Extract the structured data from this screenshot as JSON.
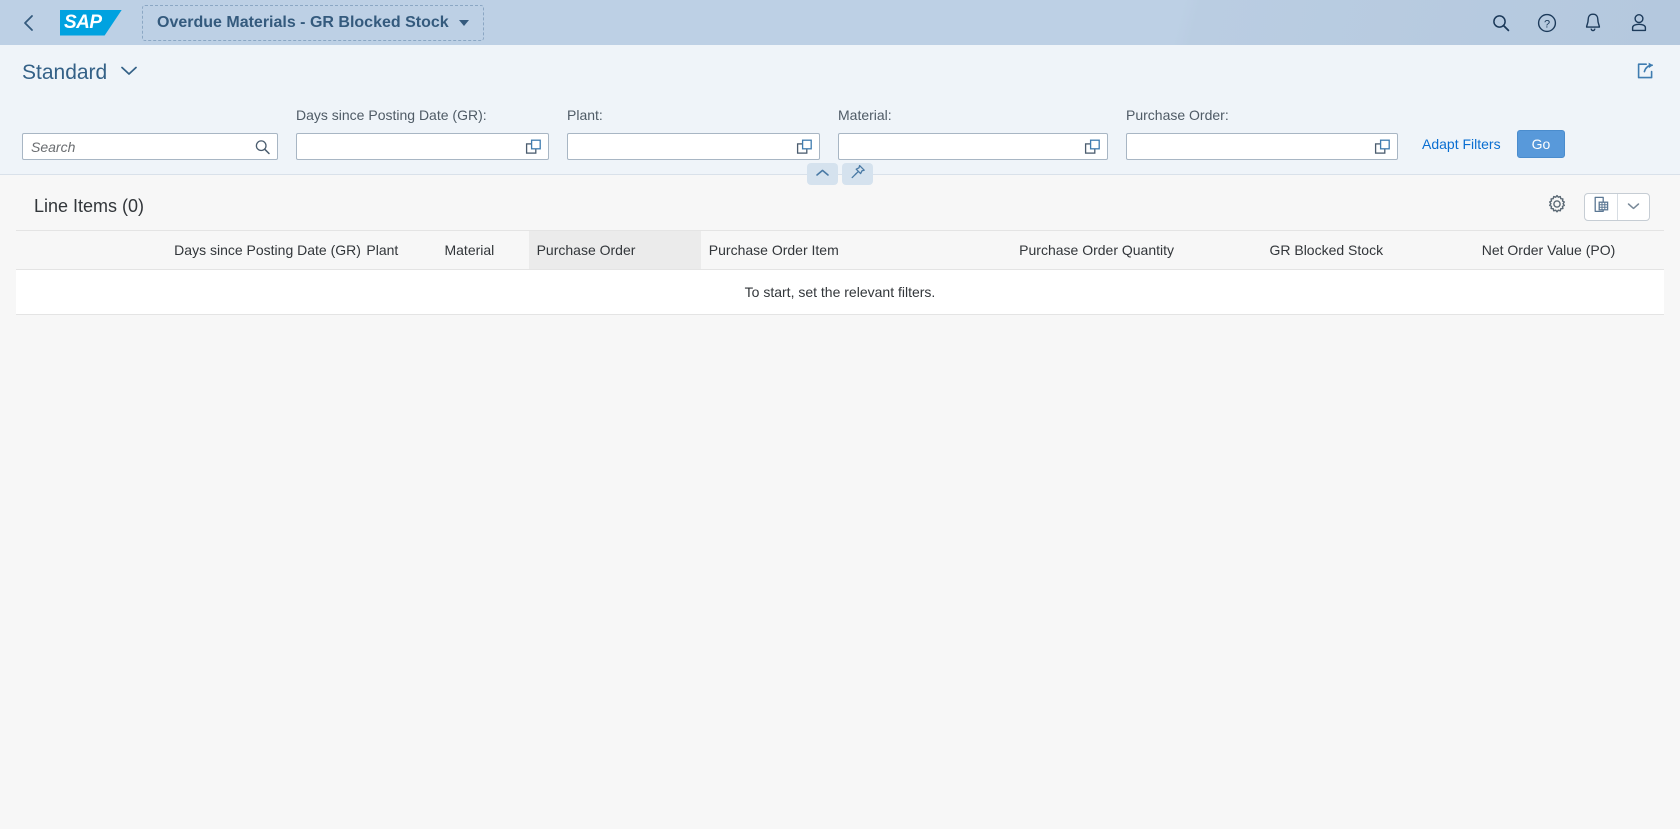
{
  "shellbar": {
    "back_icon": "back-chevron-icon",
    "logo_text": "SAP",
    "app_title": "Overdue Materials - GR Blocked Stock",
    "icons": [
      {
        "name": "search-icon",
        "label": "Search"
      },
      {
        "name": "help-icon",
        "label": "Help"
      },
      {
        "name": "notifications-bell-icon",
        "label": "Notifications"
      },
      {
        "name": "user-avatar-icon",
        "label": "User"
      }
    ]
  },
  "variant": {
    "name": "Standard",
    "chevron": "chevron-down-icon",
    "share_icon": "share-export-icon"
  },
  "filters": {
    "search": {
      "placeholder": "Search",
      "value": "",
      "icon": "search-icon"
    },
    "fields": [
      {
        "label": "Days since Posting Date (GR):",
        "value": "",
        "placeholder": "",
        "icon": "value-help-icon",
        "key": "days"
      },
      {
        "label": "Plant:",
        "value": "",
        "placeholder": "",
        "icon": "value-help-icon",
        "key": "plant"
      },
      {
        "label": "Material:",
        "value": "",
        "placeholder": "",
        "icon": "value-help-icon",
        "key": "material"
      },
      {
        "label": "Purchase Order:",
        "value": "",
        "placeholder": "",
        "icon": "value-help-icon",
        "key": "purchase_order"
      }
    ],
    "adapt_filters_label": "Adapt Filters",
    "go_label": "Go",
    "collapse_icon": "chevron-up-icon",
    "pin_icon": "pin-icon"
  },
  "table": {
    "title": "Line Items (0)",
    "settings_icon": "gear-icon",
    "export_icon": "spreadsheet-export-icon",
    "export_menu_icon": "chevron-down-icon",
    "columns": [
      {
        "label": "Days since Posting Date (GR)",
        "hover": false
      },
      {
        "label": "Plant",
        "hover": false
      },
      {
        "label": "Material",
        "hover": false
      },
      {
        "label": "Purchase Order",
        "hover": true
      },
      {
        "label": "Purchase Order Item",
        "hover": false
      },
      {
        "label": "Purchase Order Quantity",
        "hover": false
      },
      {
        "label": "GR Blocked Stock",
        "hover": false
      },
      {
        "label": "Net Order Value (PO)",
        "hover": false
      }
    ],
    "rows": [],
    "empty_message": "To start, set the relevant filters."
  },
  "colors": {
    "shell_bg": "#bdd0e5",
    "brand_blue": "#00a2e0",
    "accent_link": "#0a6ed1",
    "go_button": "#5899da",
    "title_text": "#346187",
    "page_bg": "#f7f7f7"
  }
}
